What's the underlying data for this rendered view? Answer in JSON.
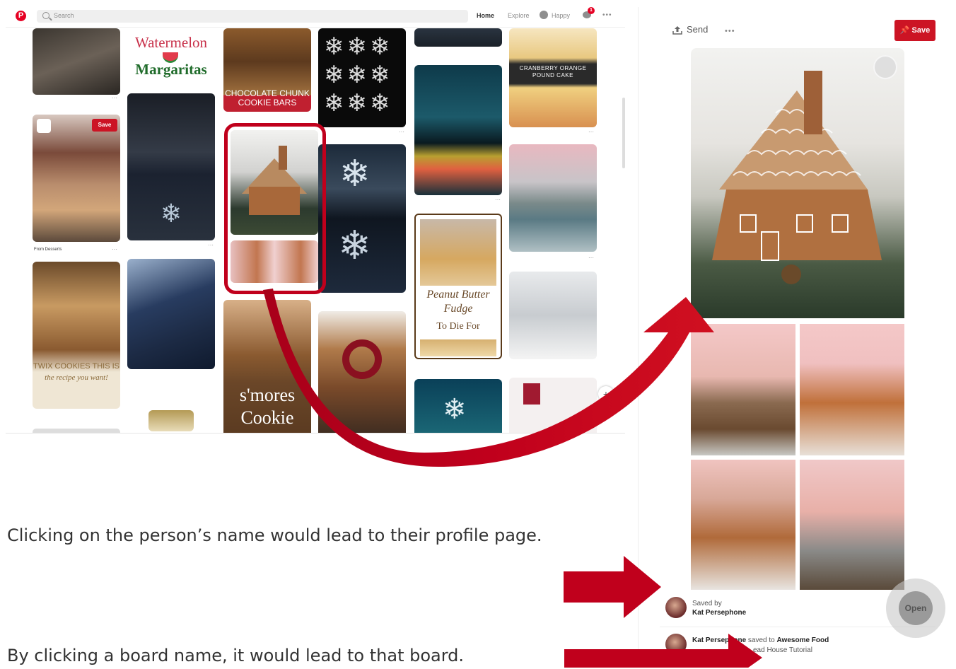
{
  "pinterest": {
    "logo": "P",
    "search_placeholder": "Search",
    "nav": {
      "home": "Home",
      "explore": "Explore",
      "user": "Happy",
      "notif_count": "1",
      "more": "•••"
    },
    "pins": {
      "watermelon_1": "Watermelon",
      "watermelon_2": "Margaritas",
      "cookie_bars": "CHOCOLATE CHUNK\nCOOKIE BARS",
      "cranberry": "CRANBERRY ORANGE\nPOUND CAKE",
      "save": "Save",
      "from_label": "From Desserts",
      "peanut_1": "Peanut Butter",
      "peanut_2": "Fudge",
      "peanut_3": "To Die For",
      "twix": "TWIX COOKIES THIS IS",
      "twix_2": "the recipe you want!",
      "smores_1": "s'mores",
      "smores_2": "Cookie"
    }
  },
  "panel": {
    "send_label": "Send",
    "more": "•••",
    "save_label": "Save",
    "saved_by_label": "Saved by",
    "saved_by_name": "Kat Persephone",
    "activity_name": "Kat Persephone",
    "activity_text": "saved to",
    "board_name": "Awesome Food",
    "pin_title": "ead House Tutorial",
    "open_label": "Open"
  },
  "captions": {
    "profile": "Clicking on the person’s name would lead to their profile page.",
    "board": "By clicking a board name, it would lead to that board."
  },
  "colors": {
    "brand_red": "#e60023",
    "arrow_red": "#c0001c"
  }
}
